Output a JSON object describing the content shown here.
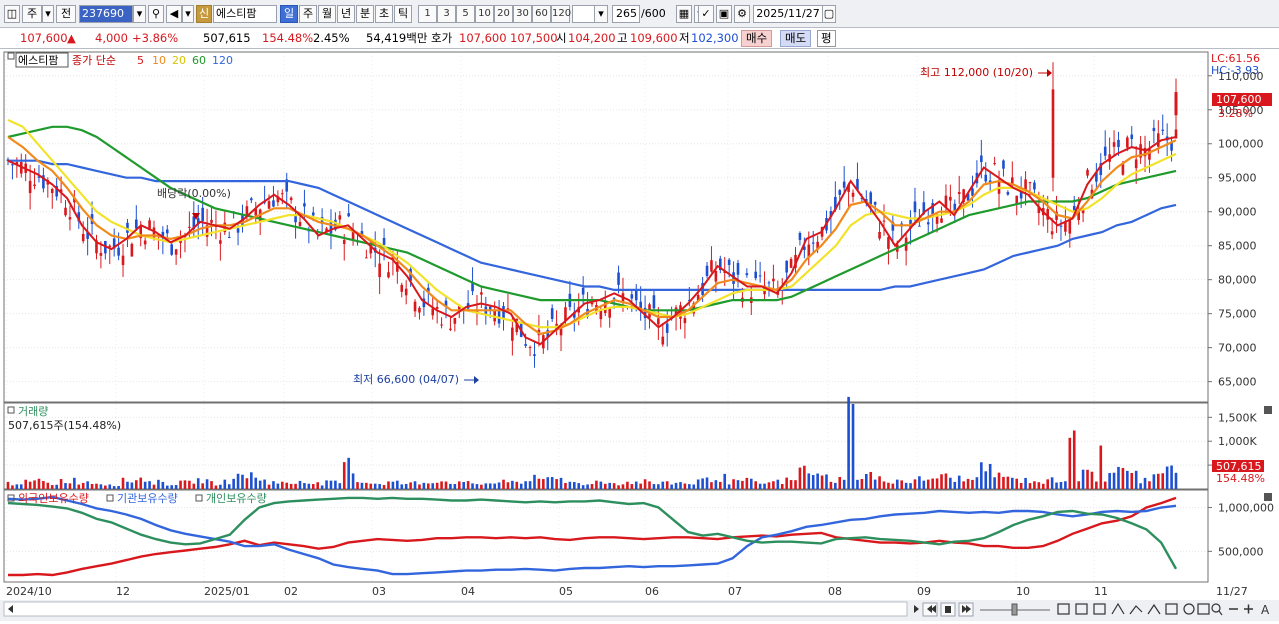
{
  "toolbar": {
    "period_type": "주",
    "prev_label": "전",
    "code": "237690",
    "credit_badge": "신",
    "stock_name": "에스티팜",
    "intervals": [
      "일",
      "주",
      "월",
      "년",
      "분",
      "초",
      "틱"
    ],
    "active_interval": "일",
    "minute_options": [
      "1",
      "3",
      "5",
      "10",
      "20",
      "30",
      "60",
      "120"
    ],
    "count_value": "265",
    "count_total": "/600",
    "date_value": "2025/11/27"
  },
  "quote": {
    "price": "107,600",
    "change_arrow": "▲",
    "change": "4,000",
    "change_pct": "+3.86%",
    "volume": "507,615",
    "volume_ratio": "154.48%",
    "turnover_rate": "2.45%",
    "amount": "54,419백만",
    "ask_label": "호가",
    "ask": "107,600",
    "bid": "107,500",
    "open_label": "시",
    "open": "104,200",
    "high_label": "고",
    "high": "109,600",
    "low_label": "저",
    "low": "102,300",
    "sell_button": "매수",
    "buy_button": "매도",
    "eval_button": "평"
  },
  "price_panel": {
    "name_tag": "에스티팜",
    "indicator_label": "종가 단순",
    "ma_labels": [
      "5",
      "10",
      "20",
      "60",
      "120"
    ],
    "lc_label": "LC:61.56",
    "hc_label": "HC:-3.93",
    "current_price_tag": "107,600",
    "current_pct_tag": "3.28%",
    "high_annotation": "최고 112,000 (10/20)",
    "low_annotation": "최저 66,600 (04/07)",
    "dividend_annotation": "배당락(0.00%)",
    "y_ticks": [
      "110,000",
      "105,000",
      "100,000",
      "95,000",
      "90,000",
      "85,000",
      "80,000",
      "75,000",
      "70,000",
      "65,000"
    ]
  },
  "volume_panel": {
    "title": "거래량",
    "value_label": "507,615주(154.48%)",
    "y_ticks": [
      "1,500K",
      "1,000K",
      "500K"
    ],
    "current_tag": "507,615",
    "current_pct": "154.48%"
  },
  "holding_panel": {
    "legends": [
      "외국인보유수량",
      "기관보유수량",
      "개인보유수량"
    ],
    "y_ticks": [
      "1,000,000",
      "500,000"
    ]
  },
  "x_axis": {
    "labels": [
      "2024/10",
      "12",
      "2025/01",
      "02",
      "03",
      "04",
      "05",
      "06",
      "07",
      "08",
      "09",
      "10",
      "11"
    ],
    "end_date": "11/27"
  },
  "colors": {
    "up": "#d8181d",
    "down": "#1d4fd1",
    "ma5": "#d8181d",
    "ma10": "#f08a1c",
    "ma20": "#f2e22a",
    "ma60": "#1f9a2c",
    "ma120": "#3366dd",
    "foreign": "#d8181d",
    "institution": "#3366dd",
    "individual": "#2e8f5e"
  },
  "chart_data": [
    {
      "type": "candlestick",
      "x_start": "2024/10",
      "x_end": "2025/11/27",
      "ylim": [
        65000,
        112000
      ],
      "annotations": {
        "high": {
          "value": 112000,
          "date": "10/20"
        },
        "low": {
          "value": 66600,
          "date": "04/07"
        }
      },
      "series": [
        {
          "name": "5",
          "values": [
            97500,
            96500,
            95500,
            94000,
            92000,
            88000,
            85500,
            84500,
            86000,
            88000,
            87000,
            85500,
            86500,
            88500,
            88000,
            87500,
            89000,
            91000,
            92500,
            91000,
            89000,
            86500,
            87500,
            88000,
            86000,
            84000,
            83000,
            80500,
            77000,
            75500,
            74500,
            76000,
            76500,
            76000,
            75000,
            71500,
            70500,
            72500,
            74500,
            76500,
            77000,
            78000,
            77000,
            75000,
            73000,
            74500,
            76500,
            79000,
            82000,
            80500,
            79000,
            79000,
            78000,
            81000,
            86000,
            87000,
            90500,
            94500,
            91500,
            88500,
            85000,
            87500,
            90000,
            91500,
            89500,
            93000,
            96500,
            95000,
            93500,
            92500,
            90000,
            88000,
            89000,
            94000,
            97000,
            98500,
            99500,
            99000,
            100500,
            101000
          ]
        },
        {
          "name": "10",
          "values": [
            101000,
            99500,
            97500,
            96000,
            93500,
            90500,
            88000,
            86500,
            86000,
            86500,
            86500,
            86000,
            86500,
            87500,
            88000,
            88000,
            88500,
            89500,
            90500,
            90500,
            89500,
            88500,
            88000,
            87500,
            86500,
            85000,
            83500,
            81500,
            79000,
            77000,
            75500,
            75500,
            75500,
            75500,
            75500,
            73500,
            72000,
            72500,
            73500,
            75000,
            76000,
            77000,
            76500,
            75500,
            74500,
            74500,
            75500,
            77500,
            79500,
            80000,
            79500,
            79000,
            78500,
            80000,
            83000,
            85000,
            87500,
            91000,
            91500,
            90000,
            88000,
            88000,
            89000,
            90000,
            90000,
            91500,
            94000,
            94500,
            94000,
            93000,
            91500,
            89500,
            89000,
            91500,
            94500,
            96500,
            98000,
            98500,
            99500,
            100500
          ]
        },
        {
          "name": "20",
          "values": [
            103500,
            102500,
            100000,
            97500,
            95000,
            92500,
            90000,
            88500,
            87500,
            86500,
            86000,
            85500,
            86000,
            86500,
            87000,
            87500,
            88000,
            88500,
            89000,
            89500,
            89500,
            89000,
            88500,
            87500,
            86500,
            85500,
            84000,
            82500,
            80500,
            78500,
            77000,
            75500,
            75000,
            74500,
            74000,
            73500,
            73000,
            73000,
            73500,
            74500,
            75500,
            76000,
            76000,
            75500,
            75000,
            74500,
            75000,
            76000,
            77000,
            78000,
            78500,
            78500,
            78500,
            79000,
            81000,
            83000,
            85000,
            88000,
            89500,
            90000,
            89500,
            89000,
            89000,
            89500,
            90000,
            91000,
            92500,
            93500,
            93500,
            93000,
            92000,
            91000,
            90000,
            90500,
            92000,
            94000,
            95500,
            96500,
            97500,
            98500
          ]
        },
        {
          "name": "60",
          "values": [
            101000,
            101500,
            102000,
            102500,
            102500,
            102000,
            101000,
            99500,
            98000,
            96500,
            95000,
            93500,
            92500,
            91500,
            90500,
            90000,
            89500,
            89000,
            88500,
            88000,
            87500,
            87000,
            86500,
            86000,
            85500,
            85000,
            84500,
            84000,
            83000,
            82000,
            81000,
            80000,
            79000,
            78500,
            78000,
            77500,
            77000,
            77000,
            77000,
            77000,
            77000,
            76500,
            76000,
            75500,
            75500,
            75500,
            75500,
            76000,
            76500,
            77000,
            77000,
            77000,
            77000,
            77500,
            78500,
            79500,
            80500,
            81500,
            82500,
            83500,
            84500,
            85500,
            86500,
            87500,
            88500,
            89500,
            90000,
            90500,
            91000,
            91500,
            91500,
            91500,
            91500,
            92000,
            93000,
            94000,
            94500,
            95000,
            95500,
            96000
          ]
        },
        {
          "name": "120",
          "values": [
            97500,
            97500,
            97500,
            97000,
            97000,
            96500,
            96000,
            95500,
            95000,
            95000,
            94500,
            94500,
            94500,
            94500,
            94500,
            94500,
            94500,
            94500,
            94500,
            94500,
            94000,
            93500,
            92500,
            91500,
            90500,
            89500,
            88500,
            87500,
            86500,
            85500,
            84500,
            83500,
            82500,
            82000,
            81500,
            81000,
            80500,
            80000,
            79500,
            79000,
            79000,
            78500,
            78500,
            78500,
            78500,
            78500,
            78500,
            78500,
            78500,
            78500,
            78500,
            78500,
            78500,
            78500,
            78500,
            78500,
            78500,
            78500,
            78500,
            78500,
            79000,
            79000,
            79500,
            80000,
            80500,
            81000,
            81500,
            82500,
            83500,
            84000,
            84500,
            85000,
            86000,
            86500,
            87000,
            88000,
            88500,
            89500,
            90500,
            91000
          ]
        }
      ]
    },
    {
      "type": "bar",
      "title": "거래량",
      "ylim": [
        0,
        1800000
      ],
      "values": [
        120,
        140,
        160,
        110,
        180,
        150,
        130,
        100,
        170,
        220,
        140,
        110,
        130,
        180,
        120,
        160,
        300,
        200,
        140,
        120,
        180,
        110,
        130,
        500,
        160,
        120,
        140,
        110,
        130,
        180,
        150,
        120,
        110,
        130,
        140,
        160,
        300,
        180,
        140,
        110,
        150,
        120,
        140,
        160,
        110,
        130,
        120,
        180,
        230,
        150,
        170,
        120,
        150,
        180,
        400,
        250,
        200,
        1600,
        300,
        200,
        180,
        160,
        200,
        250,
        220,
        180,
        400,
        300,
        200,
        180,
        150,
        200,
        1350,
        300,
        1300,
        400,
        300,
        200,
        420,
        508
      ]
    },
    {
      "type": "line",
      "ylim": [
        200000,
        1200000
      ],
      "series": [
        {
          "name": "외국인보유수량",
          "values": [
            230,
            230,
            240,
            230,
            260,
            300,
            330,
            360,
            400,
            440,
            470,
            490,
            510,
            530,
            550,
            580,
            620,
            570,
            600,
            580,
            560,
            530,
            550,
            600,
            620,
            640,
            630,
            620,
            630,
            650,
            650,
            660,
            660,
            650,
            660,
            650,
            660,
            640,
            630,
            650,
            660,
            660,
            650,
            640,
            650,
            660,
            660,
            650,
            640,
            660,
            670,
            680,
            670,
            690,
            700,
            710,
            660,
            640,
            620,
            600,
            600,
            590,
            600,
            620,
            600,
            590,
            560,
            560,
            540,
            540,
            560,
            620,
            700,
            760,
            820,
            850,
            900,
            1000,
            1050,
            1110
          ]
        },
        {
          "name": "기관보유수량",
          "values": [
            1100,
            1090,
            1100,
            1120,
            1080,
            1040,
            990,
            960,
            920,
            870,
            800,
            740,
            700,
            670,
            640,
            610,
            560,
            560,
            580,
            520,
            470,
            420,
            350,
            320,
            300,
            280,
            240,
            240,
            250,
            260,
            270,
            280,
            280,
            290,
            290,
            300,
            290,
            280,
            300,
            310,
            310,
            320,
            330,
            320,
            330,
            330,
            340,
            350,
            360,
            420,
            560,
            660,
            690,
            730,
            780,
            800,
            830,
            860,
            870,
            900,
            920,
            930,
            940,
            960,
            950,
            940,
            950,
            940,
            960,
            960,
            950,
            920,
            900,
            920,
            950,
            960,
            950,
            960,
            1000,
            1020
          ]
        },
        {
          "name": "개인보유수량",
          "values": [
            1050,
            1040,
            1030,
            1010,
            990,
            940,
            870,
            830,
            760,
            690,
            640,
            600,
            580,
            590,
            640,
            690,
            860,
            1000,
            1050,
            1070,
            1080,
            1090,
            1100,
            1110,
            1110,
            1100,
            1110,
            1100,
            1100,
            1090,
            1080,
            1080,
            1090,
            1080,
            1070,
            1060,
            1070,
            1060,
            1070,
            1070,
            1080,
            1060,
            1040,
            1050,
            1000,
            860,
            720,
            680,
            700,
            660,
            620,
            600,
            610,
            610,
            600,
            590,
            640,
            650,
            660,
            640,
            630,
            620,
            600,
            580,
            610,
            620,
            650,
            720,
            800,
            860,
            900,
            950,
            960,
            930,
            920,
            880,
            820,
            750,
            600,
            300
          ]
        }
      ]
    }
  ]
}
